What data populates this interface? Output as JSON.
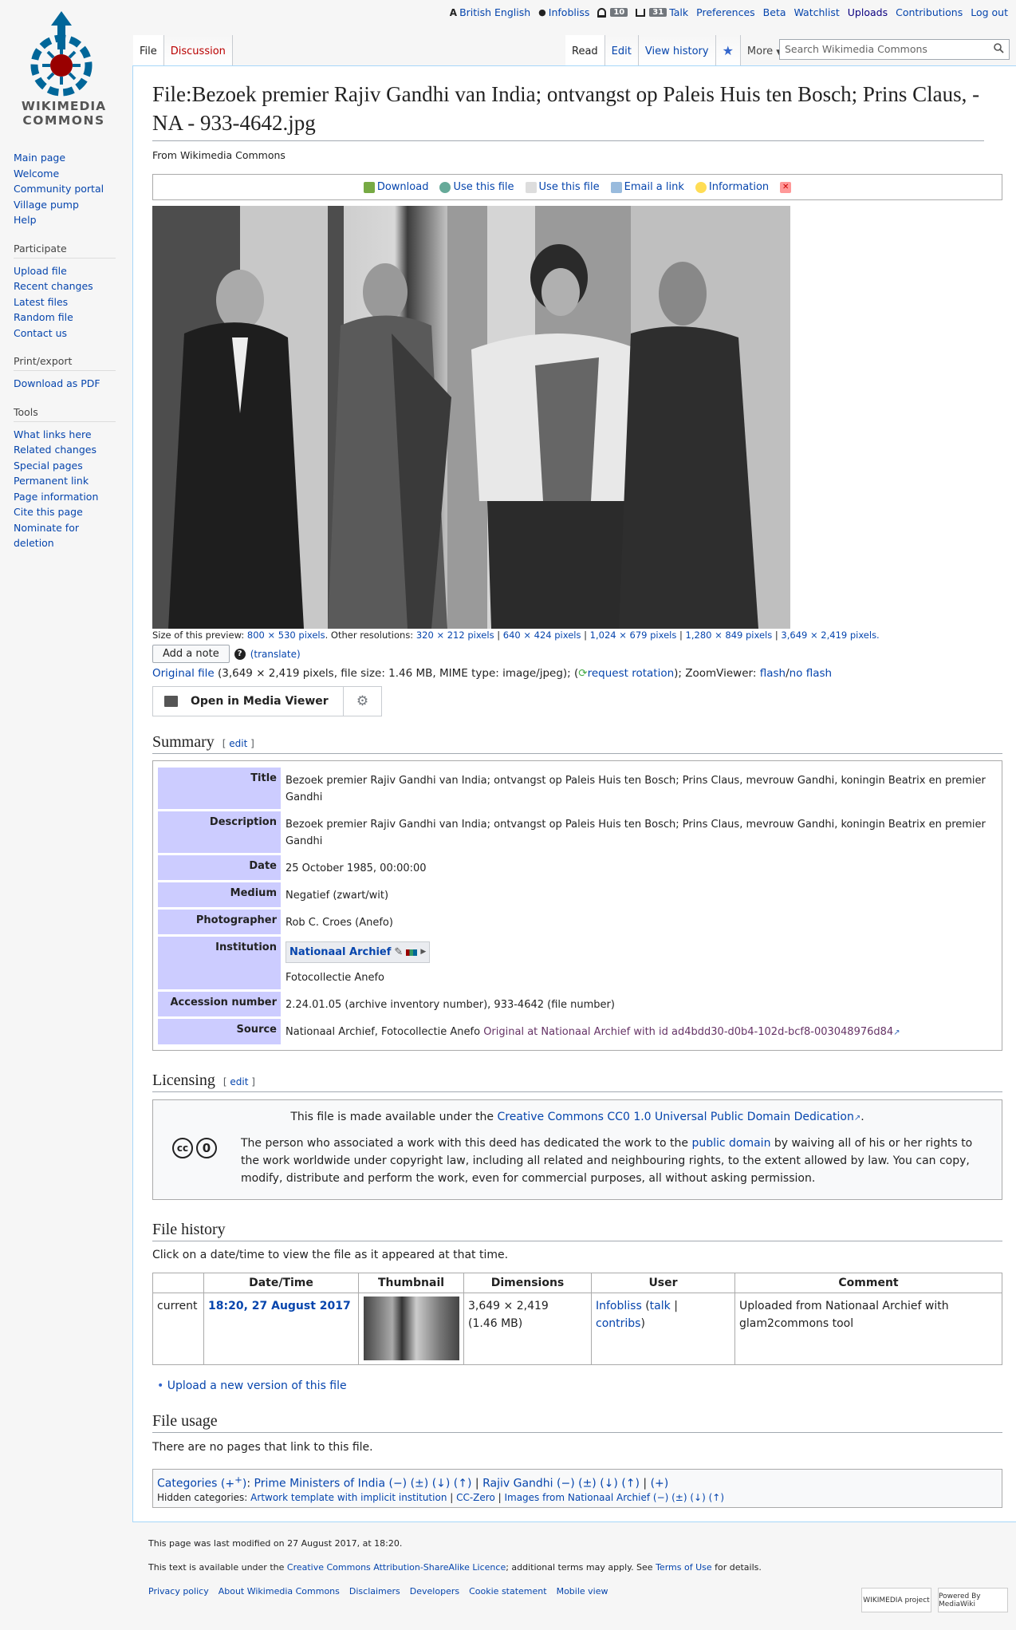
{
  "personal": {
    "language": "British English",
    "user": "Infobliss",
    "alerts_count": "10",
    "notices_count": "31",
    "talk": "Talk",
    "preferences": "Preferences",
    "beta": "Beta",
    "watchlist": "Watchlist",
    "uploads": "Uploads",
    "contributions": "Contributions",
    "logout": "Log out"
  },
  "logo": {
    "line1": "WIKIMEDIA",
    "line2": "COMMONS"
  },
  "sidebar": {
    "nav": [
      "Main page",
      "Welcome",
      "Community portal",
      "Village pump",
      "Help"
    ],
    "participate_title": "Participate",
    "participate": [
      "Upload file",
      "Recent changes",
      "Latest files",
      "Random file",
      "Contact us"
    ],
    "print_title": "Print/export",
    "print": [
      "Download as PDF"
    ],
    "tools_title": "Tools",
    "tools": [
      "What links here",
      "Related changes",
      "Special pages",
      "Permanent link",
      "Page information",
      "Cite this page",
      "Nominate for deletion"
    ]
  },
  "tabs": {
    "file": "File",
    "discussion": "Discussion",
    "read": "Read",
    "edit": "Edit",
    "history": "View history",
    "more": "More",
    "search_placeholder": "Search Wikimedia Commons"
  },
  "page": {
    "title": "File:Bezoek premier Rajiv Gandhi van India; ontvangst op Paleis Huis ten Bosch; Prins Claus, - NA - 933-4642.jpg",
    "site_sub": "From Wikimedia Commons"
  },
  "toolbox": [
    "Download",
    "Use this file",
    "Use this file",
    "Email a link",
    "Information"
  ],
  "preview": {
    "size_label": "Size of this preview:",
    "size_value": "800 × 530 pixels",
    "other_label": "Other resolutions:",
    "resolutions": [
      "320 × 212 pixels",
      "640 × 424 pixels",
      "1,024 × 679 pixels",
      "1,280 × 849 pixels",
      "3,649 × 2,419 pixels."
    ],
    "add_note": "Add a note",
    "translate": "(translate)",
    "original_file": "Original file",
    "original_info": "(3,649 × 2,419 pixels, file size: 1.46 MB, MIME type: image/jpeg); (",
    "request_rotation": "request rotation",
    "zoom_label": "); ZoomViewer:",
    "flash": "flash",
    "no_flash": "no flash",
    "media_viewer": "Open in Media Viewer"
  },
  "summary": {
    "heading": "Summary",
    "edit": "edit",
    "rows": [
      {
        "label": "Title",
        "value": "Bezoek premier Rajiv Gandhi van India; ontvangst op Paleis Huis ten Bosch; Prins Claus, mevrouw Gandhi, koningin Beatrix en premier Gandhi"
      },
      {
        "label": "Description",
        "value": "Bezoek premier Rajiv Gandhi van India; ontvangst op Paleis Huis ten Bosch; Prins Claus, mevrouw Gandhi, koningin Beatrix en premier Gandhi"
      },
      {
        "label": "Date",
        "value": "25 October 1985, 00:00:00"
      },
      {
        "label": "Medium",
        "value": "Negatief (zwart/wit)"
      },
      {
        "label": "Photographer",
        "value": "Rob C. Croes (Anefo)"
      },
      {
        "label": "Institution",
        "value": "Fotocollectie Anefo"
      },
      {
        "label": "Accession number",
        "value": "2.24.01.05 (archive inventory number), 933-4642 (file number)"
      },
      {
        "label": "Source",
        "value": "Nationaal Archief, Fotocollectie Anefo"
      }
    ],
    "institution_name": "Nationaal Archief",
    "source_link": "Original at Nationaal Archief with id ad4bdd30-d0b4-102d-bcf8-003048976d84"
  },
  "licensing": {
    "heading": "Licensing",
    "edit": "edit",
    "line1_prefix": "This file is made available under the",
    "line1_link": "Creative Commons CC0 1.0 Universal Public Domain Dedication",
    "text_before": "The person who associated a work with this deed has dedicated the work to the",
    "pd_link": "public domain",
    "text_after": "by waiving all of his or her rights to the work worldwide under copyright law, including all related and neighbouring rights, to the extent allowed by law. You can copy, modify, distribute and perform the work, even for commercial purposes, all without asking permission."
  },
  "file_history": {
    "heading": "File history",
    "note": "Click on a date/time to view the file as it appeared at that time.",
    "columns": [
      "",
      "Date/Time",
      "Thumbnail",
      "Dimensions",
      "User",
      "Comment"
    ],
    "row": {
      "status": "current",
      "datetime": "18:20, 27 August 2017",
      "dimensions": "3,649 × 2,419",
      "size": "(1.46 MB)",
      "user": "Infobliss",
      "talk": "talk",
      "contribs": "contribs",
      "comment": "Uploaded from Nationaal Archief with glam2commons tool"
    },
    "upload_new": "Upload a new version of this file"
  },
  "file_usage": {
    "heading": "File usage",
    "text": "There are no pages that link to this file."
  },
  "categories": {
    "label": "Categories",
    "cat1": "Prime Ministers of India",
    "cat2": "Rajiv Gandhi",
    "controls": "(−) (±) (↓) (↑)",
    "plus": "(+)",
    "hidden_label": "Hidden categories:",
    "hidden1": "Artwork template with implicit institution",
    "hidden2": "CC-Zero",
    "hidden3": "Images from Nationaal Archief"
  },
  "footer": {
    "modified": "This page was last modified on 27 August 2017, at 18:20.",
    "license_prefix": "This text is available under the",
    "license_link": "Creative Commons Attribution-ShareAlike Licence",
    "license_mid": "; additional terms may apply. See",
    "terms_link": "Terms of Use",
    "license_suffix": "for details.",
    "links": [
      "Privacy policy",
      "About Wikimedia Commons",
      "Disclaimers",
      "Developers",
      "Cookie statement",
      "Mobile view"
    ],
    "icon1": "WIKIMEDIA project",
    "icon2": "Powered By MediaWiki"
  },
  "colors": {
    "link": "#0645ad",
    "label_bg": "#ccccff",
    "border": "#a7d7f9"
  }
}
